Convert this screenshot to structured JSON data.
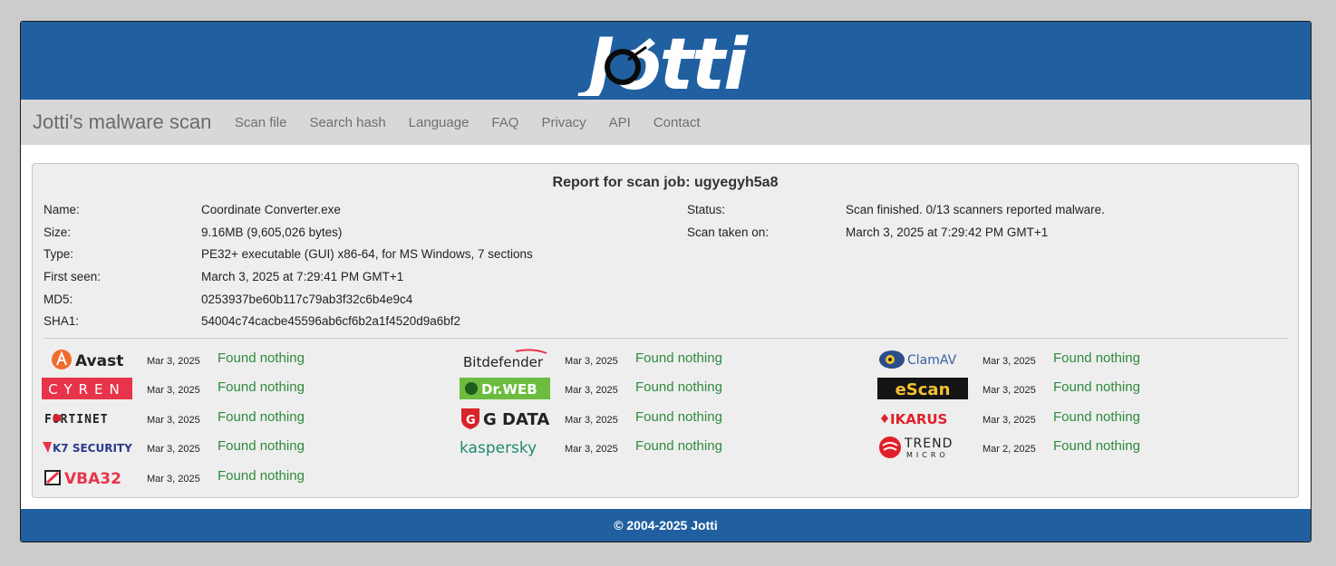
{
  "header": {
    "logo_text": "Jotti",
    "colors": {
      "bar": "#2160a0",
      "nav": "#d8d8d8",
      "found_nothing": "#2e8a3c"
    }
  },
  "nav": {
    "brand": "Jotti's malware scan",
    "items": [
      {
        "label": "Scan file"
      },
      {
        "label": "Search hash"
      },
      {
        "label": "Language"
      },
      {
        "label": "FAQ"
      },
      {
        "label": "Privacy"
      },
      {
        "label": "API"
      },
      {
        "label": "Contact"
      }
    ]
  },
  "report": {
    "title": "Report for scan job: ugyegyh5a8",
    "left_fields": [
      {
        "label": "Name:",
        "value": "Coordinate Converter.exe"
      },
      {
        "label": "Size:",
        "value": "9.16MB (9,605,026 bytes)"
      },
      {
        "label": "Type:",
        "value": "PE32+ executable (GUI) x86-64, for MS Windows, 7 sections"
      },
      {
        "label": "First seen:",
        "value": "March 3, 2025 at 7:29:41 PM GMT+1"
      },
      {
        "label": "MD5:",
        "value": "0253937be60b117c79ab3f32c6b4e9c4"
      },
      {
        "label": "SHA1:",
        "value": "54004c74cacbe45596ab6cf6b2a1f4520d9a6bf2"
      }
    ],
    "right_fields": [
      {
        "label": "Status:",
        "value": "Scan finished. 0/13 scanners reported malware."
      },
      {
        "label": "Scan taken on:",
        "value": "March 3, 2025 at 7:29:42 PM GMT+1"
      }
    ]
  },
  "scanners": [
    {
      "name": "Avast",
      "date": "Mar 3, 2025",
      "result": "Found nothing",
      "icon": "avast-logo"
    },
    {
      "name": "CYREN",
      "date": "Mar 3, 2025",
      "result": "Found nothing",
      "icon": "cyren-logo"
    },
    {
      "name": "FORTINET",
      "date": "Mar 3, 2025",
      "result": "Found nothing",
      "icon": "fortinet-logo"
    },
    {
      "name": "K7 SECURITY",
      "date": "Mar 3, 2025",
      "result": "Found nothing",
      "icon": "k7-logo"
    },
    {
      "name": "VBA32",
      "date": "Mar 3, 2025",
      "result": "Found nothing",
      "icon": "vba32-logo"
    },
    {
      "name": "Bitdefender",
      "date": "Mar 3, 2025",
      "result": "Found nothing",
      "icon": "bitdefender-logo"
    },
    {
      "name": "Dr.WEB",
      "date": "Mar 3, 2025",
      "result": "Found nothing",
      "icon": "drweb-logo"
    },
    {
      "name": "G DATA",
      "date": "Mar 3, 2025",
      "result": "Found nothing",
      "icon": "gdata-logo"
    },
    {
      "name": "kaspersky",
      "date": "Mar 3, 2025",
      "result": "Found nothing",
      "icon": "kaspersky-logo"
    },
    {
      "name": "ClamAV",
      "date": "Mar 3, 2025",
      "result": "Found nothing",
      "icon": "clamav-logo"
    },
    {
      "name": "eScan",
      "date": "Mar 3, 2025",
      "result": "Found nothing",
      "icon": "escan-logo"
    },
    {
      "name": "IKARUS",
      "date": "Mar 3, 2025",
      "result": "Found nothing",
      "icon": "ikarus-logo"
    },
    {
      "name": "TREND",
      "sub": "MICRO",
      "date": "Mar 2, 2025",
      "result": "Found nothing",
      "icon": "trendmicro-logo"
    }
  ],
  "footer": {
    "text": "© 2004-2025 Jotti"
  }
}
